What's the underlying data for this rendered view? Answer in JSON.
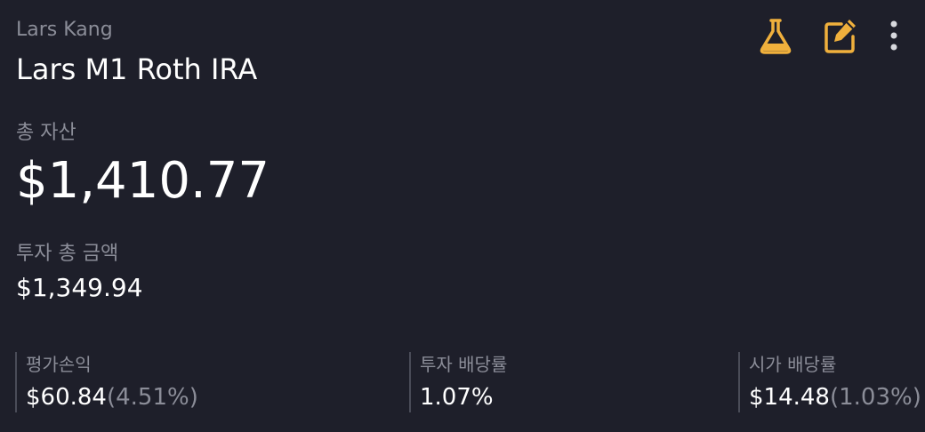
{
  "header": {
    "owner": "Lars Kang",
    "account_name": "Lars M1 Roth IRA"
  },
  "toolbar": {
    "icons": [
      "flask-icon",
      "edit-icon",
      "more-vertical-icon"
    ],
    "accent_color": "#f0b03c"
  },
  "total_assets": {
    "label": "총 자산",
    "value": "$1,410.77"
  },
  "total_invested": {
    "label": "투자 총 금액",
    "value": "$1,349.94"
  },
  "metrics": [
    {
      "label": "평가손익",
      "value": "$60.84",
      "sub": "(4.51%)"
    },
    {
      "label": "투자 배당률",
      "value": "1.07%",
      "sub": ""
    },
    {
      "label": "시가 배당률",
      "value": "$14.48",
      "sub": "(1.03%)"
    }
  ]
}
